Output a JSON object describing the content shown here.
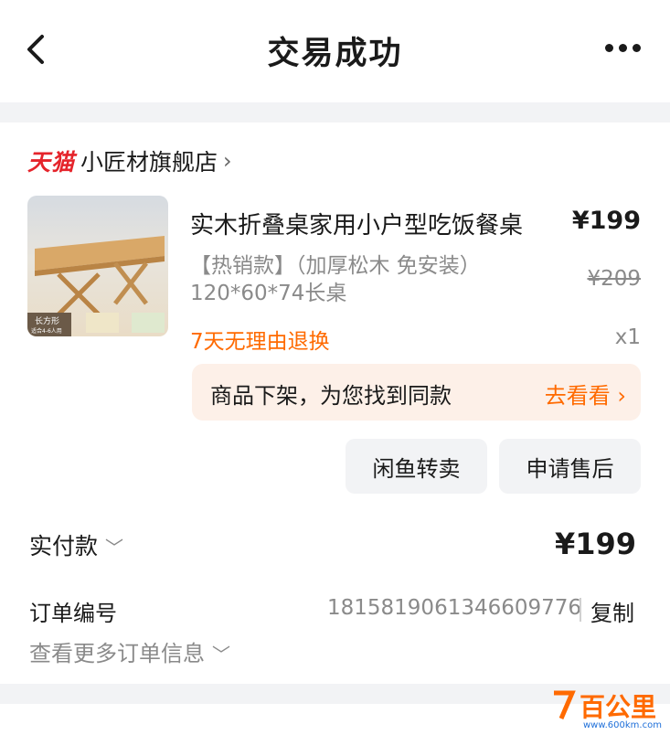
{
  "header": {
    "title": "交易成功"
  },
  "store": {
    "brand": "天猫",
    "name": "小匠材旗舰店",
    "chevron": "›"
  },
  "product": {
    "name": "实木折叠桌家用小户型吃饭餐桌",
    "price": "¥199",
    "spec": "【热销款】（加厚松木 免安装）120*60*74长桌",
    "original_price": "¥209",
    "return_policy": "7天无理由退换",
    "quantity": "x1",
    "image_tag": "长方形",
    "image_sub": "适合4-6人用"
  },
  "notice": {
    "text": "商品下架，为您找到同款",
    "link": "去看看 ›"
  },
  "actions": {
    "resell": "闲鱼转卖",
    "after_sale": "申请售后"
  },
  "payment": {
    "label": "实付款",
    "amount": "¥199"
  },
  "order": {
    "label": "订单编号",
    "number": "1815819061346609776",
    "copy": "复制",
    "more": "查看更多订单信息"
  },
  "watermark": {
    "brand": "百公里",
    "url": "www.600km.com"
  },
  "colors": {
    "accent": "#ff6a00",
    "tmall": "#e5242b",
    "notice_bg": "#fdf0e8",
    "button_bg": "#f2f3f5"
  }
}
